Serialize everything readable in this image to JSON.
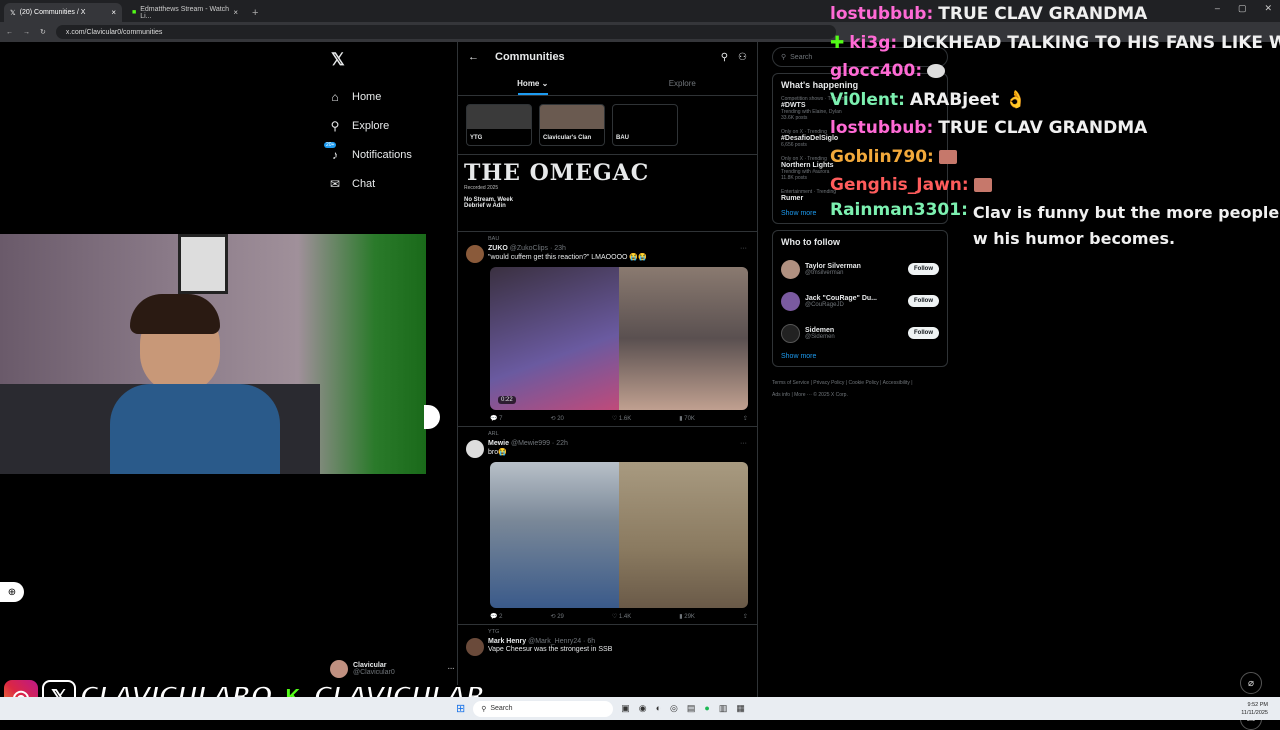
{
  "browser": {
    "tabs": [
      {
        "title": "(20) Communities / X"
      },
      {
        "title": "Edmatthews Stream - Watch Li..."
      }
    ],
    "url": "x.com/Clavicular0/communities"
  },
  "nav": {
    "items": [
      {
        "label": "Home",
        "icon": "home-icon"
      },
      {
        "label": "Explore",
        "icon": "search-icon"
      },
      {
        "label": "Notifications",
        "icon": "bell-icon",
        "badge": "20+"
      },
      {
        "label": "Chat",
        "icon": "mail-icon"
      }
    ],
    "profile_name": "Clavicular",
    "profile_handle": "@Clavicular0"
  },
  "communities": {
    "title": "Communities",
    "tabs": [
      "Home",
      "Explore"
    ],
    "list": [
      "YTG",
      "Clavicular's Clan",
      "BAU"
    ],
    "banner_logo": "THE OMEGAC",
    "banner_subtitle": "Recorded 2025",
    "banner_caption": "No Stream, Week Debrief w Adin"
  },
  "posts": [
    {
      "context": "BAU",
      "name": "ZUKO",
      "handle": "@ZukoClips · 23h",
      "text": "\"would cuffem get this reaction?\" LMAOOOO 😭😭",
      "video_time": "0:22",
      "replies": "7",
      "reposts": "20",
      "likes": "1.6K",
      "views": "70K"
    },
    {
      "context": "ARL",
      "name": "Mewie",
      "handle": "@Mewie999 · 22h",
      "text": "bro😭",
      "replies": "2",
      "reposts": "29",
      "likes": "1.4K",
      "views": "29K"
    },
    {
      "context": "YTG",
      "name": "Mark Henry",
      "handle": "@Mark_Henry24 · 6h",
      "text": "Vape Cheesur was the strongest in SSB"
    }
  ],
  "sidebar": {
    "search_placeholder": "Search",
    "happening_title": "What's happening",
    "trends": [
      {
        "meta": "Competition shows · Trending",
        "name": "#DWTS",
        "extra": "Trending with Elaine, Dylan",
        "count": "33.6K posts"
      },
      {
        "meta": "Only on X · Trending",
        "name": "#DesafioDelSiglo",
        "extra": "",
        "count": "6,656 posts"
      },
      {
        "meta": "Only on X · Trending",
        "name": "Northern Lights",
        "extra": "Trending with #aurora",
        "count": "11.8K posts"
      },
      {
        "meta": "Entertainment · Trending",
        "name": "Rumer",
        "extra": "",
        "count": ""
      }
    ],
    "show_more": "Show more",
    "follow_title": "Who to follow",
    "follow": [
      {
        "name": "Taylor Silverman",
        "handle": "@tmsilverman",
        "button": "Follow"
      },
      {
        "name": "Jack \"CouRage\" Du...",
        "handle": "@CouRageJD",
        "button": "Follow"
      },
      {
        "name": "Sidemen",
        "handle": "@Sidemen",
        "button": "Follow"
      }
    ],
    "follow_show_more": "Show more",
    "footer": "Terms of Service | Privacy Policy | Cookie Policy | Accessibility | Ads info | More ··· © 2025 X Corp."
  },
  "chat": [
    {
      "user": "lostubbub:",
      "color": "#ff6ad5",
      "msg": "TRUE CLAV GRANDMA"
    },
    {
      "user": "ki3g:",
      "color": "#ff6ad5",
      "msg": "DICKHEAD TALKING TO HIS FANS LIKE WE BU"
    },
    {
      "user": "glocc400:",
      "color": "#ff6ad5",
      "msg": ""
    },
    {
      "user": "Vi0lent:",
      "color": "#7cf0b0",
      "msg": "ARABjeet 👌"
    },
    {
      "user": "lostubbub:",
      "color": "#ff6ad5",
      "msg": "TRUE CLAV GRANDMA"
    },
    {
      "user": "Goblin790:",
      "color": "#f2a93b",
      "msg": ""
    },
    {
      "user": "Genghis_Jawn:",
      "color": "#ff5c5c",
      "msg": ""
    },
    {
      "user": "Rainman3301:",
      "color": "#7cf0b0",
      "msg": "Clav is funny but the more people w his humor becomes."
    }
  ],
  "taskbar": {
    "search": "Search",
    "time": "9:52 PM",
    "date": "11/11/2025"
  },
  "overlay": {
    "brand1": "CLAVICULARO",
    "brand2": "CLAVICULAR"
  }
}
